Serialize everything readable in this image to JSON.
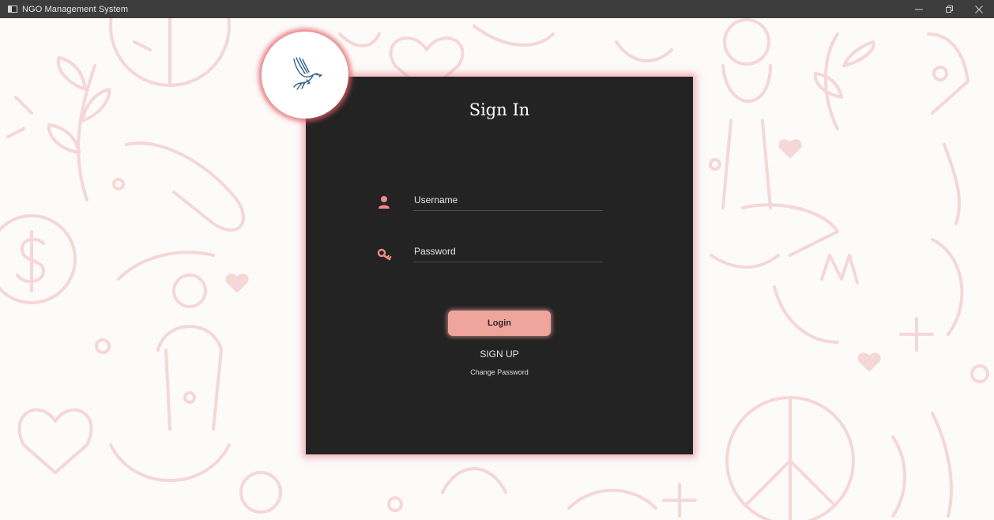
{
  "window": {
    "title": "NGO Management System",
    "controls": {
      "minimize": "minimize-icon",
      "maximize": "restore-icon",
      "close": "close-icon"
    }
  },
  "background": {
    "pattern": "charity-doodle-pattern",
    "color": "#fdfafa",
    "line_color": "#f7dcdc"
  },
  "login": {
    "logo": "dove-icon",
    "title": "Sign In",
    "username": {
      "icon": "user-icon",
      "placeholder": "Username",
      "value": ""
    },
    "password": {
      "icon": "key-icon",
      "placeholder": "Password",
      "value": ""
    },
    "login_label": "Login",
    "signup_label": "SIGN UP",
    "change_password_label": "Change Password"
  },
  "colors": {
    "card": "#232323",
    "accent": "#f0a59c",
    "glow": "#e8787d",
    "icon": "#f08b86",
    "titlebar": "#3c3c3c"
  }
}
